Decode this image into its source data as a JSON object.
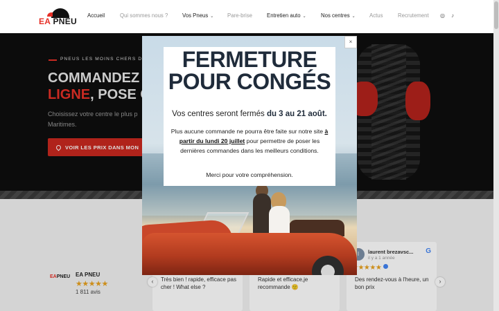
{
  "colors": {
    "accent": "#e63027",
    "dark": "#0e0e0e",
    "star": "#e9a21f",
    "google_blue": "#4285f4"
  },
  "header": {
    "logo": {
      "ea": "EA",
      "pneu": "PNEU"
    },
    "nav": [
      {
        "label": "Accueil",
        "dim": false,
        "dropdown": false
      },
      {
        "label": "Qui sommes nous ?",
        "dim": true,
        "dropdown": false
      },
      {
        "label": "Vos Pneus",
        "dim": false,
        "dropdown": true
      },
      {
        "label": "Pare-brise",
        "dim": true,
        "dropdown": false
      },
      {
        "label": "Entretien auto",
        "dim": false,
        "dropdown": true
      },
      {
        "label": "Nos centres",
        "dim": false,
        "dropdown": true
      },
      {
        "label": "Actus",
        "dim": true,
        "dropdown": false
      },
      {
        "label": "Recrutement",
        "dim": true,
        "dropdown": false
      }
    ],
    "social": {
      "instagram_icon": "instagram-icon",
      "tiktok_icon": "tiktok-icon"
    }
  },
  "hero": {
    "kicker": "PNEUS LES MOINS CHERS DU",
    "title_line1": "COMMANDEZ",
    "title_line2_red": "LIGNE",
    "title_line2_rest": ", POSE CO",
    "desc_line1": "Choisissez votre centre le plus p",
    "desc_line2": "Maritimes.",
    "cta_label": "VOIR LES PRIX DANS MON"
  },
  "reviews": {
    "brand": {
      "logo_ea": "EA",
      "logo_pneu": "PNEU",
      "name": "EA PNEU",
      "stars": "★★★★★",
      "count": "1 811 avis"
    },
    "cards": [
      {
        "text": "Très bien ! rapide, efficace pas cher ! What else ?"
      },
      {
        "text": "Rapide et efficace,je recommande 🙂"
      },
      {
        "author": "laurent brezavsc...",
        "date": "il y a 1 année",
        "avatar": "l",
        "stars": "★★★★★",
        "text": "Des rendez-vous à l'heure, un bon prix"
      }
    ],
    "prev": "‹",
    "next": "›"
  },
  "modal": {
    "title_line1": "FERMETURE",
    "title_line2": "POUR CONGÉS",
    "lead_prefix": "Vos centres seront fermés",
    "lead_bold": "du 3 au 21 août.",
    "body_prefix": "Plus aucune commande ne pourra être faite sur notre site",
    "body_bold": "à partir du lundi 20 juillet",
    "body_suffix": "pour permettre de poser les dernières commandes dans les meilleurs conditions.",
    "thanks": "Merci pour votre compréhension.",
    "close_label": "×"
  }
}
